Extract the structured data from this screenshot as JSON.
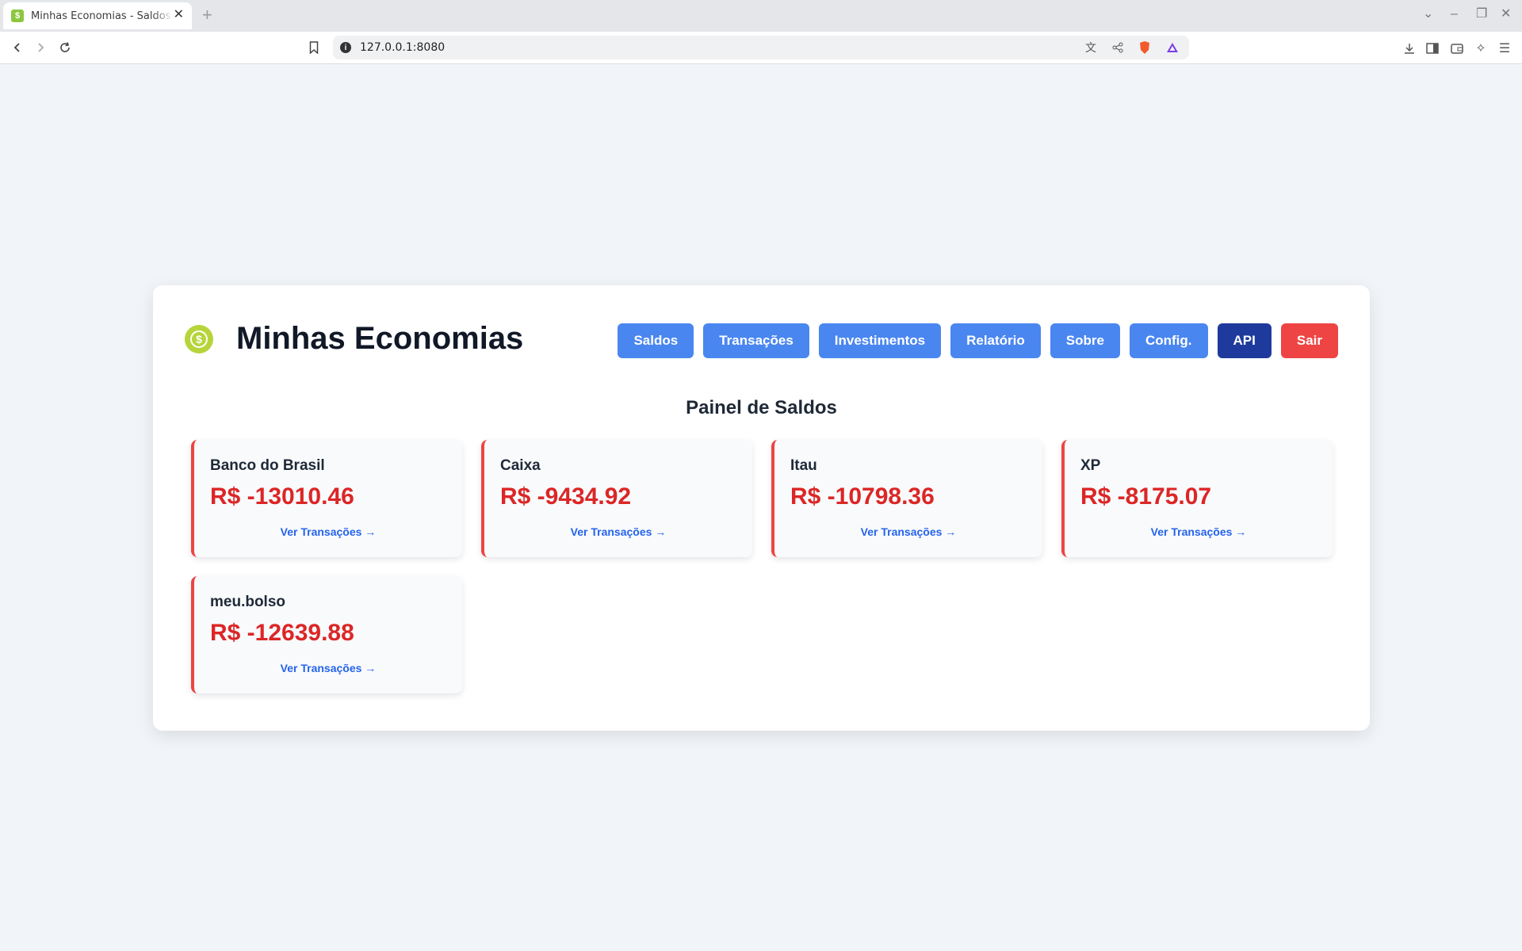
{
  "browser": {
    "tab_title": "Minhas Economias - Saldos",
    "url": "127.0.0.1:8080"
  },
  "app": {
    "title": "Minhas Economias",
    "nav": [
      "Saldos",
      "Transações",
      "Investimentos",
      "Relatório",
      "Sobre",
      "Config.",
      "API",
      "Sair"
    ]
  },
  "panel": {
    "title": "Painel de Saldos"
  },
  "accounts": [
    {
      "name": "Banco do Brasil",
      "balance": "R$ -13010.46",
      "link": "Ver Transações →"
    },
    {
      "name": "Caixa",
      "balance": "R$ -9434.92",
      "link": "Ver Transações →"
    },
    {
      "name": "Itau",
      "balance": "R$ -10798.36",
      "link": "Ver Transações →"
    },
    {
      "name": "XP",
      "balance": "R$ -8175.07",
      "link": "Ver Transações →"
    },
    {
      "name": "meu.bolso",
      "balance": "R$ -12639.88",
      "link": "Ver Transações →"
    }
  ],
  "colors": {
    "accent": "#4a86f0",
    "api": "#1e3a9c",
    "danger": "#ef4444",
    "negative_balance": "#dc2626",
    "link": "#2563eb",
    "logo": "#b7d43a"
  }
}
